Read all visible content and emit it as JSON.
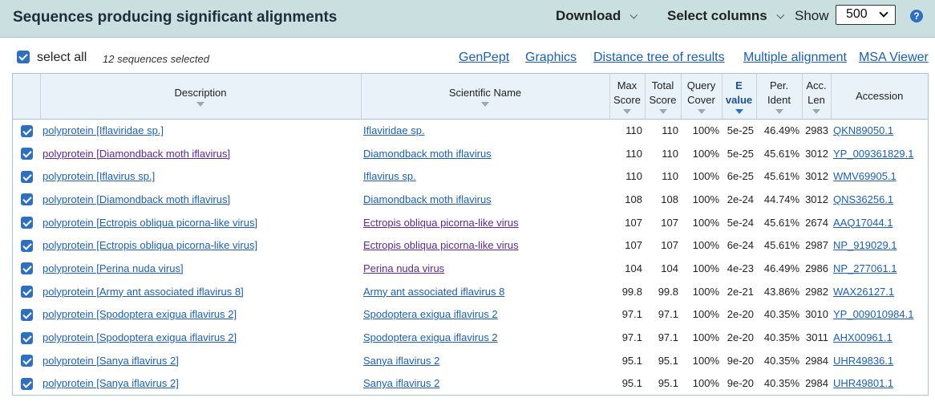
{
  "header": {
    "title": "Sequences producing significant alignments",
    "download_label": "Download",
    "select_columns_label": "Select columns",
    "show_label": "Show",
    "show_value": "500",
    "help_icon": "question-circle-icon"
  },
  "toolbar": {
    "select_all_label": "select all",
    "selected_count": "12 sequences selected",
    "links": [
      "GenPept",
      "Graphics",
      "Distance tree of results",
      "Multiple alignment",
      "MSA Viewer"
    ]
  },
  "table": {
    "columns": {
      "description": "Description",
      "scientific_name": "Scientific Name",
      "max_score": [
        "Max",
        "Score"
      ],
      "total_score": [
        "Total",
        "Score"
      ],
      "query_cover": [
        "Query",
        "Cover"
      ],
      "e_value": [
        "E",
        "value"
      ],
      "per_ident": [
        "Per.",
        "Ident"
      ],
      "acc_len": [
        "Acc.",
        "Len"
      ],
      "accession": "Accession"
    },
    "rows": [
      {
        "description": "polyprotein [Iflaviridae sp.]",
        "scientific_name": "Iflaviridae sp.",
        "max_score": "110",
        "total_score": "110",
        "query_cover": "100%",
        "e_value": "5e-25",
        "per_ident": "46.49%",
        "acc_len": "2983",
        "accession": "QKN89050.1"
      },
      {
        "description": "polyprotein [Diamondback moth iflavirus]",
        "scientific_name": "Diamondback moth iflavirus",
        "max_score": "110",
        "total_score": "110",
        "query_cover": "100%",
        "e_value": "5e-25",
        "per_ident": "45.61%",
        "acc_len": "3012",
        "accession": "YP_009361829.1"
      },
      {
        "description": "polyprotein [Iflavirus sp.]",
        "scientific_name": "Iflavirus sp.",
        "max_score": "110",
        "total_score": "110",
        "query_cover": "100%",
        "e_value": "6e-25",
        "per_ident": "45.61%",
        "acc_len": "3012",
        "accession": "WMV69905.1"
      },
      {
        "description": "polyprotein [Diamondback moth iflavirus]",
        "scientific_name": "Diamondback moth iflavirus",
        "max_score": "108",
        "total_score": "108",
        "query_cover": "100%",
        "e_value": "2e-24",
        "per_ident": "44.74%",
        "acc_len": "3012",
        "accession": "QNS36256.1"
      },
      {
        "description": "polyprotein [Ectropis obliqua picorna-like virus]",
        "scientific_name": "Ectropis obliqua picorna-like virus",
        "max_score": "107",
        "total_score": "107",
        "query_cover": "100%",
        "e_value": "5e-24",
        "per_ident": "45.61%",
        "acc_len": "2674",
        "accession": "AAQ17044.1"
      },
      {
        "description": "polyprotein [Ectropis obliqua picorna-like virus]",
        "scientific_name": "Ectropis obliqua picorna-like virus",
        "max_score": "107",
        "total_score": "107",
        "query_cover": "100%",
        "e_value": "6e-24",
        "per_ident": "45.61%",
        "acc_len": "2987",
        "accession": "NP_919029.1"
      },
      {
        "description": "polyprotein [Perina nuda virus]",
        "scientific_name": "Perina nuda virus",
        "max_score": "104",
        "total_score": "104",
        "query_cover": "100%",
        "e_value": "4e-23",
        "per_ident": "46.49%",
        "acc_len": "2986",
        "accession": "NP_277061.1"
      },
      {
        "description": "polyprotein [Army ant associated iflavirus 8]",
        "scientific_name": "Army ant associated iflavirus 8",
        "max_score": "99.8",
        "total_score": "99.8",
        "query_cover": "100%",
        "e_value": "2e-21",
        "per_ident": "43.86%",
        "acc_len": "2982",
        "accession": "WAX26127.1"
      },
      {
        "description": "polyprotein [Spodoptera exigua iflavirus 2]",
        "scientific_name": "Spodoptera exigua iflavirus 2",
        "max_score": "97.1",
        "total_score": "97.1",
        "query_cover": "100%",
        "e_value": "2e-20",
        "per_ident": "40.35%",
        "acc_len": "3010",
        "accession": "YP_009010984.1"
      },
      {
        "description": "polyprotein [Spodoptera exigua iflavirus 2]",
        "scientific_name": "Spodoptera exigua iflavirus 2",
        "max_score": "97.1",
        "total_score": "97.1",
        "query_cover": "100%",
        "e_value": "2e-20",
        "per_ident": "40.35%",
        "acc_len": "3011",
        "accession": "AHX00961.1"
      },
      {
        "description": "polyprotein [Sanya iflavirus 2]",
        "scientific_name": "Sanya iflavirus 2",
        "max_score": "95.1",
        "total_score": "95.1",
        "query_cover": "100%",
        "e_value": "9e-20",
        "per_ident": "40.35%",
        "acc_len": "2984",
        "accession": "UHR49836.1"
      },
      {
        "description": "polyprotein [Sanya iflavirus 2]",
        "scientific_name": "Sanya iflavirus 2",
        "max_score": "95.1",
        "total_score": "95.1",
        "query_cover": "100%",
        "e_value": "9e-20",
        "per_ident": "40.35%",
        "acc_len": "2984",
        "accession": "UHR49801.1"
      }
    ]
  },
  "colors": {
    "header_bg": "#c9dfe0",
    "link": "#1f5fa8",
    "visited_link": "#5a2a8a",
    "checkbox": "#2f6fbf",
    "table_header_bg": "#e8f2f8"
  }
}
